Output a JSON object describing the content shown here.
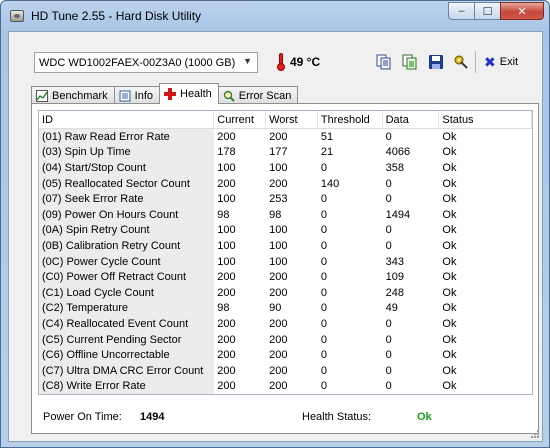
{
  "window": {
    "title": "HD Tune 2.55 - Hard Disk Utility",
    "buttons": {
      "minimize": "–",
      "maximize": "☐",
      "close": "✕"
    }
  },
  "toolbar": {
    "drive": "WDC WD1002FAEX-00Z3A0 (1000 GB)",
    "temperature": "49 °C",
    "icons": [
      "copy-text-icon",
      "copy-screenshot-icon",
      "save-icon",
      "options-icon"
    ],
    "exit_label": "Exit"
  },
  "tabs": [
    {
      "label": "Benchmark",
      "icon": "benchmark-icon",
      "active": false
    },
    {
      "label": "Info",
      "icon": "info-icon",
      "active": false
    },
    {
      "label": "Health",
      "icon": "health-icon",
      "active": true
    },
    {
      "label": "Error Scan",
      "icon": "error-scan-icon",
      "active": false
    }
  ],
  "health": {
    "columns": [
      "ID",
      "Current",
      "Worst",
      "Threshold",
      "Data",
      "Status"
    ],
    "rows": [
      [
        "(01) Raw Read Error Rate",
        "200",
        "200",
        "51",
        "0",
        "Ok"
      ],
      [
        "(03) Spin Up Time",
        "178",
        "177",
        "21",
        "4066",
        "Ok"
      ],
      [
        "(04) Start/Stop Count",
        "100",
        "100",
        "0",
        "358",
        "Ok"
      ],
      [
        "(05) Reallocated Sector Count",
        "200",
        "200",
        "140",
        "0",
        "Ok"
      ],
      [
        "(07) Seek Error Rate",
        "100",
        "253",
        "0",
        "0",
        "Ok"
      ],
      [
        "(09) Power On Hours Count",
        "98",
        "98",
        "0",
        "1494",
        "Ok"
      ],
      [
        "(0A) Spin Retry Count",
        "100",
        "100",
        "0",
        "0",
        "Ok"
      ],
      [
        "(0B) Calibration Retry Count",
        "100",
        "100",
        "0",
        "0",
        "Ok"
      ],
      [
        "(0C) Power Cycle Count",
        "100",
        "100",
        "0",
        "343",
        "Ok"
      ],
      [
        "(C0) Power Off Retract Count",
        "200",
        "200",
        "0",
        "109",
        "Ok"
      ],
      [
        "(C1) Load Cycle Count",
        "200",
        "200",
        "0",
        "248",
        "Ok"
      ],
      [
        "(C2) Temperature",
        "98",
        "90",
        "0",
        "49",
        "Ok"
      ],
      [
        "(C4) Reallocated Event Count",
        "200",
        "200",
        "0",
        "0",
        "Ok"
      ],
      [
        "(C5) Current Pending Sector",
        "200",
        "200",
        "0",
        "0",
        "Ok"
      ],
      [
        "(C6) Offline Uncorrectable",
        "200",
        "200",
        "0",
        "0",
        "Ok"
      ],
      [
        "(C7) Ultra DMA CRC Error Count",
        "200",
        "200",
        "0",
        "0",
        "Ok"
      ],
      [
        "(C8) Write Error Rate",
        "200",
        "200",
        "0",
        "0",
        "Ok"
      ]
    ]
  },
  "footer": {
    "power_on_label": "Power On Time:",
    "power_on_value": "1494",
    "health_status_label": "Health Status:",
    "health_status_value": "Ok"
  },
  "colors": {
    "status_ok": "#19a019",
    "accent_health": "#d01818"
  }
}
